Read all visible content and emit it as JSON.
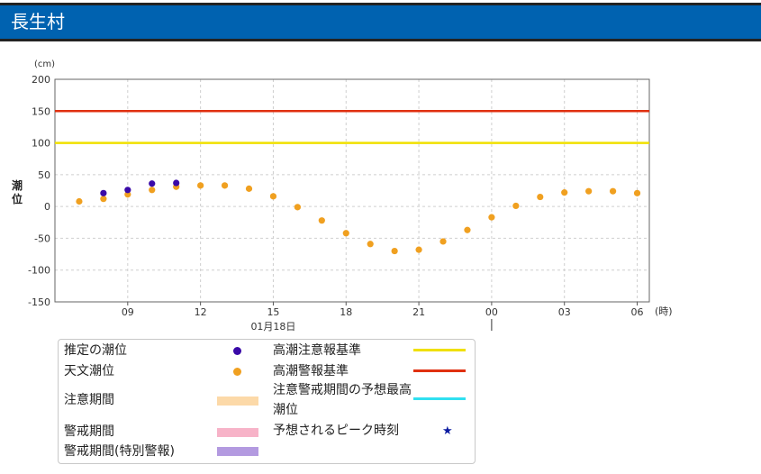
{
  "header": {
    "title": "長生村"
  },
  "colors": {
    "header_bg": "#0062b0",
    "estimated": "#3a0aa8",
    "astronomical": "#f0a020",
    "caution_line": "#f0e000",
    "warning_line": "#e03010",
    "forecast_max_line": "#30e0f0",
    "caution_band": "#fcd9a8",
    "warning_band": "#f7b3c8",
    "special_band": "#b39ae0",
    "peak_star": "#0a1aa0"
  },
  "chart_data": {
    "type": "scatter",
    "ylabel": "潮位",
    "y_unit": "(cm)",
    "x_unit": "(時)",
    "ylim": [
      -150,
      200
    ],
    "yticks": [
      -150,
      -100,
      -50,
      0,
      50,
      100,
      150,
      200
    ],
    "xlim": [
      6,
      30.5
    ],
    "xticks": [
      {
        "x": 9,
        "label": "09"
      },
      {
        "x": 12,
        "label": "12"
      },
      {
        "x": 15,
        "label": "15"
      },
      {
        "x": 18,
        "label": "18"
      },
      {
        "x": 21,
        "label": "21"
      },
      {
        "x": 24,
        "label": "00"
      },
      {
        "x": 27,
        "label": "03"
      },
      {
        "x": 30,
        "label": "06"
      }
    ],
    "date_label": {
      "x": 15,
      "label": "01月18日"
    },
    "day_boundary_x": 24,
    "grid": true,
    "thresholds": [
      {
        "name": "高潮注意報基準",
        "value": 100
      },
      {
        "name": "高潮警報基準",
        "value": 150
      }
    ],
    "series": [
      {
        "name": "推定の潮位",
        "x": [
          8,
          9,
          10,
          11
        ],
        "values": [
          21,
          26,
          36,
          37
        ]
      },
      {
        "name": "天文潮位",
        "x": [
          7,
          8,
          9,
          10,
          11,
          12,
          13,
          14,
          15,
          16,
          17,
          18,
          19,
          20,
          21,
          22,
          23,
          24,
          25,
          26,
          27,
          28,
          29,
          30
        ],
        "values": [
          8,
          12,
          19,
          26,
          31,
          33,
          33,
          28,
          16,
          -1,
          -22,
          -42,
          -59,
          -70,
          -68,
          -55,
          -37,
          -17,
          1,
          15,
          22,
          24,
          24,
          21
        ]
      }
    ]
  },
  "legend": {
    "estimated": "推定の潮位",
    "astronomical": "天文潮位",
    "caution_period": "注意期間",
    "warning_period": "警戒期間",
    "special_warning_period": "警戒期間(特別警報)",
    "caution_standard": "高潮注意報基準",
    "warning_standard": "高潮警報基準",
    "forecast_max": "注意警戒期間の予想最高潮位",
    "peak_time": "予想されるピーク時刻",
    "peak_star_icon": "star-icon"
  }
}
